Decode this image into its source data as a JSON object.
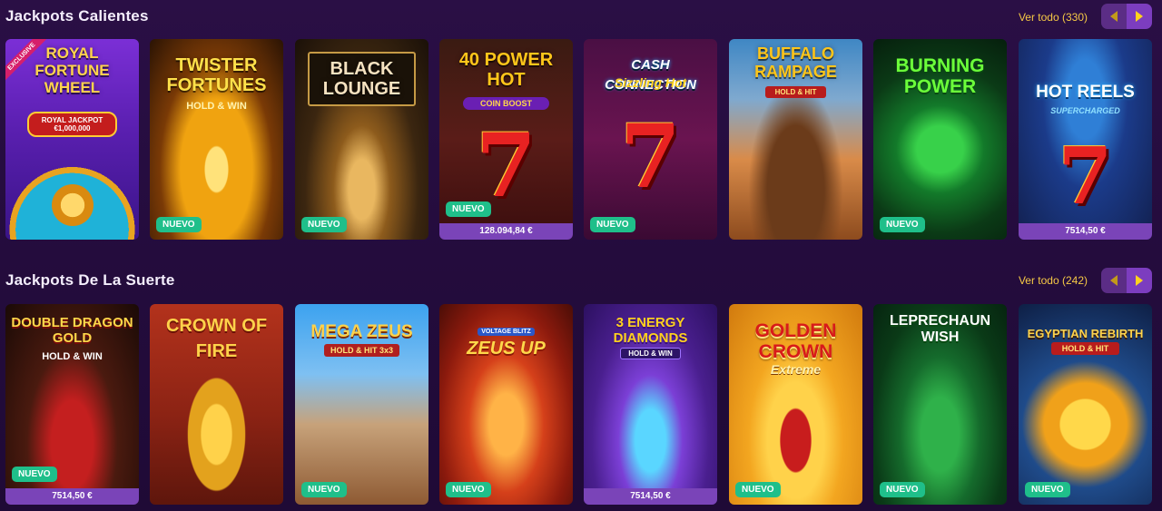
{
  "sections": [
    {
      "title": "Jackpots Calientes",
      "see_all": "Ver todo (330)",
      "games": [
        {
          "title": "Royal Fortune Wheel",
          "subtitle": "ROYAL JACKPOT €1,000,000",
          "tag": "EXCLUSIVE",
          "badge": "",
          "jackpot": ""
        },
        {
          "title": "Twister Fortunes",
          "subtitle": "HOLD & WIN",
          "badge": "NUEVO",
          "jackpot": ""
        },
        {
          "title": "Black Lounge",
          "subtitle": "",
          "badge": "NUEVO",
          "jackpot": ""
        },
        {
          "title": "40 Power Hot",
          "subtitle": "COIN BOOST",
          "badge": "NUEVO",
          "jackpot": "128.094,84 €"
        },
        {
          "title": "Cash Connection",
          "subtitle": "Sizzling Hot",
          "badge": "NUEVO",
          "jackpot": ""
        },
        {
          "title": "Buffalo Rampage",
          "subtitle": "HOLD & HIT",
          "badge": "",
          "jackpot": ""
        },
        {
          "title": "Burning Power",
          "subtitle": "",
          "badge": "NUEVO",
          "jackpot": ""
        },
        {
          "title": "Hot Reels",
          "subtitle": "SUPERCHARGED",
          "badge": "",
          "jackpot": "7514,50 €"
        }
      ]
    },
    {
      "title": "Jackpots De La Suerte",
      "see_all": "Ver todo (242)",
      "games": [
        {
          "title": "Double Dragon Gold",
          "subtitle": "HOLD & WIN",
          "badge": "NUEVO",
          "jackpot": "7514,50 €"
        },
        {
          "title": "Crown of Fire",
          "subtitle": "",
          "badge": "",
          "jackpot": ""
        },
        {
          "title": "Mega Zeus",
          "subtitle": "HOLD & HIT 3x3",
          "badge": "NUEVO",
          "jackpot": ""
        },
        {
          "title": "Zeus Up",
          "subtitle": "VOLTAGE BLITZ",
          "badge": "NUEVO",
          "jackpot": ""
        },
        {
          "title": "3 Energy Diamonds",
          "subtitle": "HOLD & WIN",
          "badge": "",
          "jackpot": "7514,50 €"
        },
        {
          "title": "Golden Crown",
          "subtitle": "Extreme",
          "badge": "NUEVO",
          "jackpot": ""
        },
        {
          "title": "Leprechaun Wish",
          "subtitle": "",
          "badge": "NUEVO",
          "jackpot": ""
        },
        {
          "title": "Egyptian Rebirth",
          "subtitle": "HOLD & HIT",
          "badge": "NUEVO",
          "jackpot": ""
        }
      ]
    }
  ],
  "icons": {
    "prev": "arrow-left-icon",
    "next": "arrow-right-icon"
  },
  "colors": {
    "background": "#2a0f45",
    "accent_link": "#f6c945",
    "new_badge": "#1fbf8a",
    "jackpot_bar": "#7a44b8",
    "nav_arrow": "#ffd21e"
  }
}
